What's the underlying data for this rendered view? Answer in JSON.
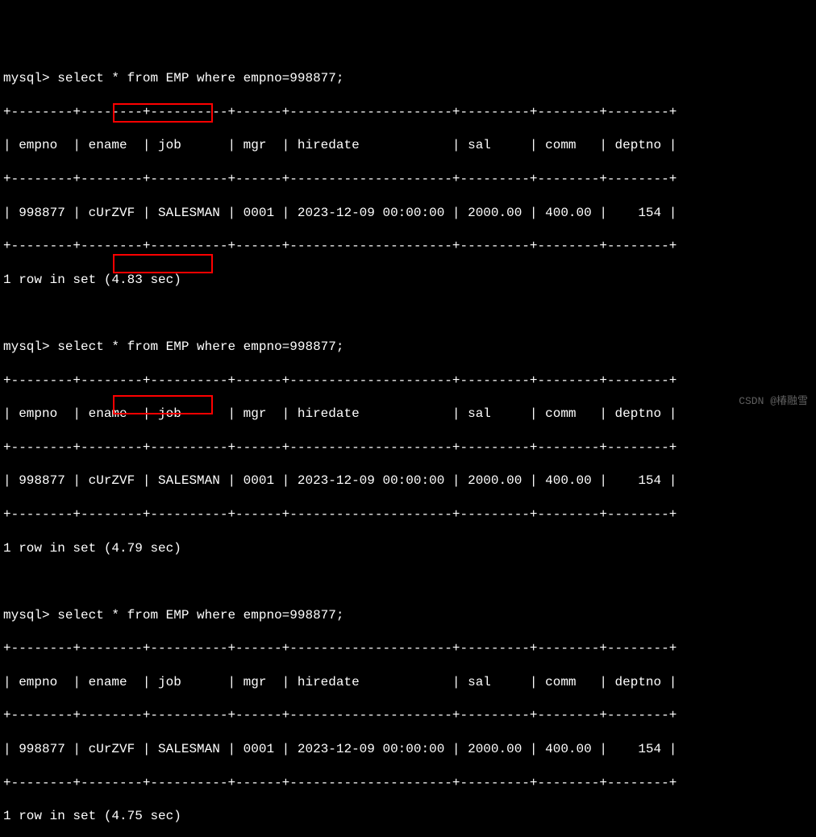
{
  "prompt": "mysql>",
  "query": "select * from EMP where empno=998877;",
  "divider_top": "+--------+--------+----------+------+---------------------+---------+--------+--------+",
  "header_row": "| empno  | ename  | job      | mgr  | hiredate            | sal     | comm   | deptno |",
  "divider_mid": "+--------+--------+----------+------+---------------------+---------+--------+--------+",
  "data_row": "| 998877 | cUrZVF | SALESMAN | 0001 | 2023-12-09 00:00:00 | 2000.00 | 400.00 |    154 |",
  "divider_bot": "+--------+--------+----------+------+---------------------+---------+--------+--------+",
  "result_prefix": "1 row in set ",
  "timings": [
    "(4.83 sec)",
    "(4.79 sec)",
    "(4.75 sec)"
  ],
  "columns": [
    "empno",
    "ename",
    "job",
    "mgr",
    "hiredate",
    "sal",
    "comm",
    "deptno"
  ],
  "row_values": {
    "empno": "998877",
    "ename": "cUrZVF",
    "job": "SALESMAN",
    "mgr": "0001",
    "hiredate": "2023-12-09 00:00:00",
    "sal": "2000.00",
    "comm": "400.00",
    "deptno": "154"
  },
  "watermark": "CSDN @椿融雪"
}
